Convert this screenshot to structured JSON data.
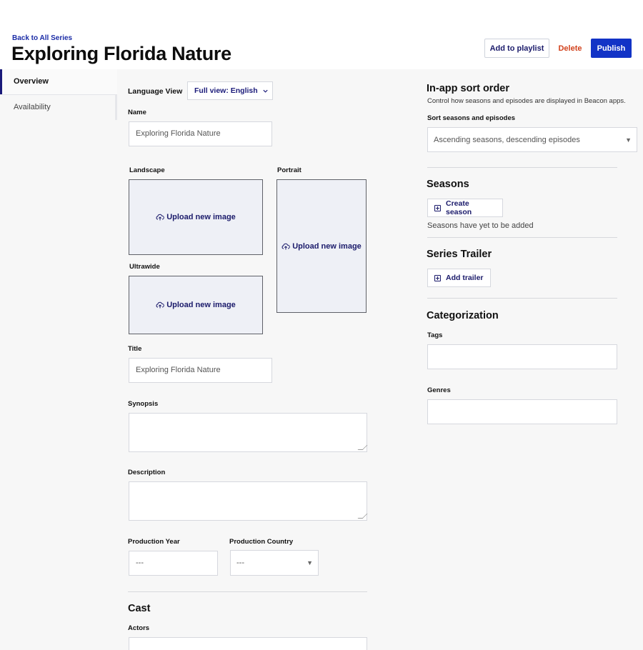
{
  "header": {
    "back_link": "Back to All Series",
    "title": "Exploring Florida Nature",
    "add_to_playlist": "Add to playlist",
    "delete": "Delete",
    "publish": "Publish"
  },
  "nav": {
    "items": [
      {
        "label": "Overview",
        "active": true
      },
      {
        "label": "Availability",
        "active": false
      }
    ]
  },
  "form": {
    "language_view_label": "Language View",
    "language_view_value": "Full view: English",
    "name_label": "Name",
    "name_value": "Exploring Florida Nature",
    "images": {
      "landscape_label": "Landscape",
      "portrait_label": "Portrait",
      "ultrawide_label": "Ultrawide",
      "upload_text": "Upload new image"
    },
    "title_label": "Title",
    "title_value": "Exploring Florida Nature",
    "synopsis_label": "Synopsis",
    "description_label": "Description",
    "production_year_label": "Production Year",
    "production_year_value": "---",
    "production_country_label": "Production Country",
    "production_country_value": "---",
    "cast_heading": "Cast",
    "actors_label": "Actors"
  },
  "right": {
    "sort_heading": "In-app sort order",
    "sort_hint": "Control how seasons and episodes are displayed in Beacon apps.",
    "sort_label": "Sort seasons and episodes",
    "sort_value": "Ascending seasons, descending episodes",
    "seasons_heading": "Seasons",
    "create_season": "Create season",
    "seasons_empty": "Seasons have yet to be added",
    "trailer_heading": "Series Trailer",
    "add_trailer": "Add trailer",
    "categorization_heading": "Categorization",
    "tags_label": "Tags",
    "genres_label": "Genres"
  },
  "colors": {
    "accent": "#1233c6",
    "link": "#1a2ba6",
    "danger": "#d2431e",
    "upload_bg": "#eef0f6"
  }
}
